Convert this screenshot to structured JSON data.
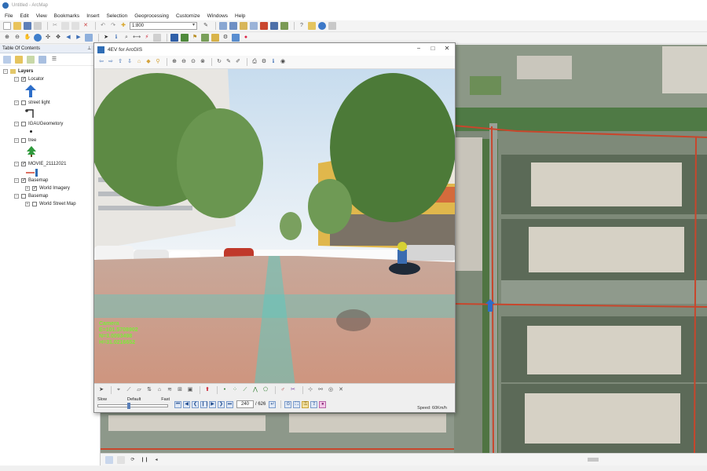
{
  "app": {
    "title": "Untitled - ArcMap"
  },
  "menu": [
    "File",
    "Edit",
    "View",
    "Bookmarks",
    "Insert",
    "Selection",
    "Geoprocessing",
    "Customize",
    "Windows",
    "Help"
  ],
  "toolbar": {
    "scale": "1:800"
  },
  "toc": {
    "title": "Table Of Contents",
    "root": "Layers",
    "layers": [
      {
        "name": "Locator",
        "checked": true
      },
      {
        "name": "street light",
        "checked": false
      },
      {
        "name": "IGAUGeometory",
        "checked": false
      },
      {
        "name": "tree",
        "checked": false
      },
      {
        "name": "MOVIE_21112021",
        "checked": true
      },
      {
        "name": "Basemap",
        "checked": true
      },
      {
        "name": "World Imagery",
        "checked": true
      },
      {
        "name": "Basemap",
        "checked": false
      },
      {
        "name": "World Street Map",
        "checked": false
      }
    ]
  },
  "streetview": {
    "title": "4EV for ArcGIS",
    "camera": {
      "label": "Camera",
      "e": "E=101.5708902",
      "n": "N=3.0093498",
      "h": "H=31.0216652"
    },
    "frame": {
      "current": "240",
      "total": "/ 626"
    },
    "speed_labels": {
      "slow": "Slow",
      "default": "Default",
      "fast": "Fast"
    },
    "speed": "Speed: 60Km/h"
  },
  "colors": {
    "accent": "#2f6db5",
    "camera_text": "#7dea3a",
    "road_line": "#c8462c"
  }
}
